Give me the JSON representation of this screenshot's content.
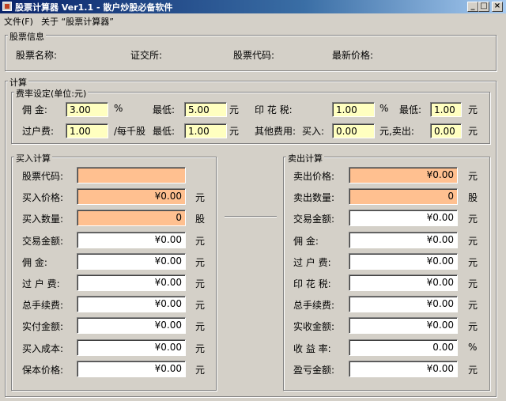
{
  "window": {
    "title": "股票计算器 Ver1.1 - 散户炒股必备软件",
    "min_glyph": "_",
    "max_glyph": "□",
    "close_glyph": "×",
    "icon_color": "#c04020"
  },
  "menu": {
    "file": "文件(F)",
    "about": "关于 “股票计算器”"
  },
  "info": {
    "title": "股票信息",
    "name_label": "股票名称:",
    "exchange_label": "证交所:",
    "code_label": "股票代码:",
    "price_label": "最新价格:"
  },
  "calc": {
    "title": "计算",
    "fees": {
      "title": "费率设定(单位:元)",
      "commission_label": "佣    金:",
      "commission_value": "3.00",
      "percent_unit": "%",
      "min_label": "最低:",
      "commission_min_value": "5.00",
      "yuan_unit": "元",
      "stamp_label": "印 花 税:",
      "stamp_value": "1.00",
      "stamp_unit": "%",
      "stamp_min_label": "最低:",
      "stamp_min_value": "1.00",
      "stamp_min_unit": "元",
      "transfer_label": "过户费:",
      "transfer_value": "1.00",
      "per_thousand_label": "/每千股",
      "transfer_min_label": "最低:",
      "transfer_min_value": "1.00",
      "transfer_min_unit": "元",
      "other_label": "其他费用:",
      "buy_label": "买入:",
      "other_buy_value": "0.00",
      "sell_label": "元,卖出:",
      "other_sell_value": "0.00",
      "other_sell_unit": "元"
    },
    "buy": {
      "title": "买入计算",
      "rows": [
        {
          "label": "股票代码:",
          "value": "",
          "unit": ""
        },
        {
          "label": "买入价格:",
          "value": "¥0.00",
          "unit": "元"
        },
        {
          "label": "买入数量:",
          "value": "0",
          "unit": "股"
        },
        {
          "label": "交易金额:",
          "value": "¥0.00",
          "unit": "元"
        },
        {
          "label": "佣     金:",
          "value": "¥0.00",
          "unit": "元"
        },
        {
          "label": "过 户 费:",
          "value": "¥0.00",
          "unit": "元"
        },
        {
          "label": "总手续费:",
          "value": "¥0.00",
          "unit": "元"
        },
        {
          "label": "实付金额:",
          "value": "¥0.00",
          "unit": "元"
        },
        {
          "label": "买入成本:",
          "value": "¥0.00",
          "unit": "元"
        },
        {
          "label": "保本价格:",
          "value": "¥0.00",
          "unit": "元"
        }
      ]
    },
    "sell": {
      "title": "卖出计算",
      "rows": [
        {
          "label": "卖出价格:",
          "value": "¥0.00",
          "unit": "元"
        },
        {
          "label": "卖出数量:",
          "value": "0",
          "unit": "股"
        },
        {
          "label": "交易金额:",
          "value": "¥0.00",
          "unit": "元"
        },
        {
          "label": "佣     金:",
          "value": "¥0.00",
          "unit": "元"
        },
        {
          "label": "过 户 费:",
          "value": "¥0.00",
          "unit": "元"
        },
        {
          "label": "印 花 税:",
          "value": "¥0.00",
          "unit": "元"
        },
        {
          "label": "总手续费:",
          "value": "¥0.00",
          "unit": "元"
        },
        {
          "label": "实收金额:",
          "value": "¥0.00",
          "unit": "元"
        },
        {
          "label": "收 益 率:",
          "value": "0.00",
          "unit": "%"
        },
        {
          "label": "盈亏金额:",
          "value": "¥0.00",
          "unit": "元"
        }
      ]
    }
  },
  "colors": {
    "input_fields": "#ffc090",
    "fee_fields": "#ffffc0",
    "output_fields": "#ffffff",
    "dialog_bg": "#d4d0c8"
  }
}
